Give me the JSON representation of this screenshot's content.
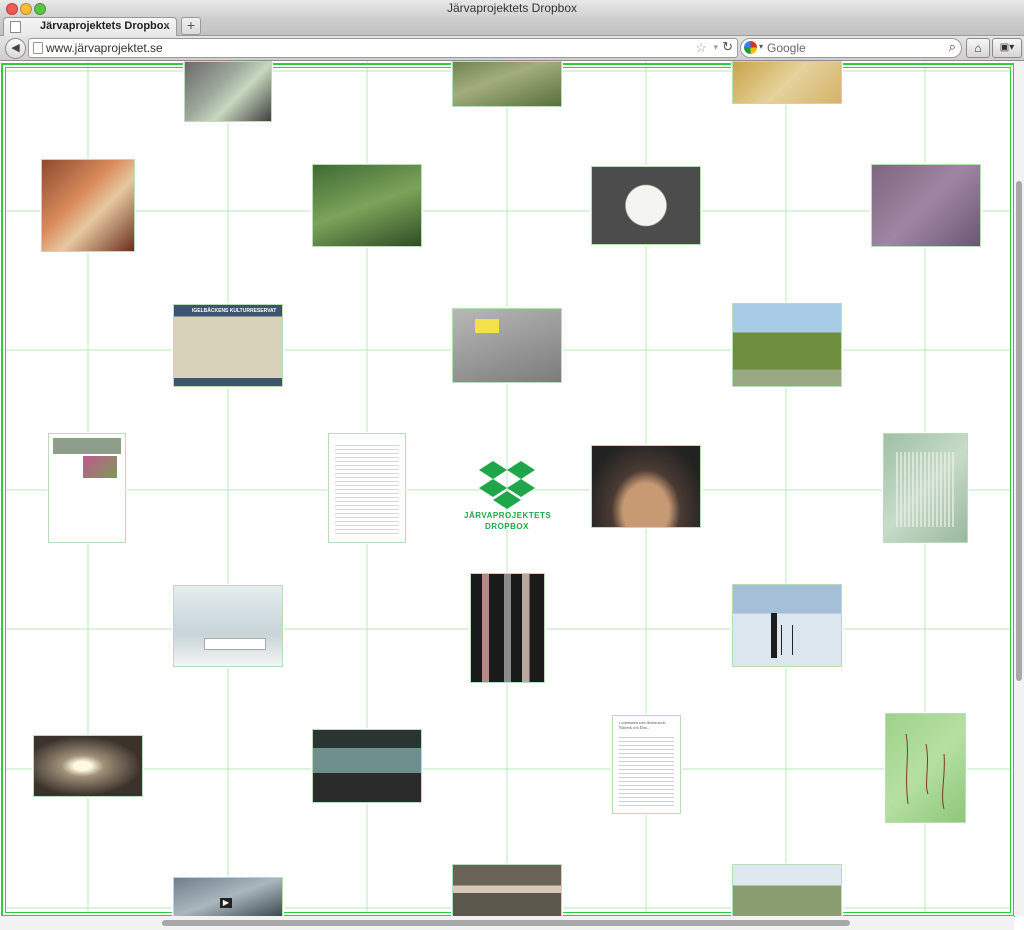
{
  "window": {
    "title": "Järvaprojektets Dropbox"
  },
  "tab": {
    "label": "Järvaprojektets Dropbox",
    "close": "×",
    "new_tab": "+"
  },
  "nav": {
    "back": "◀",
    "url": "www.järvaprojektet.se",
    "search_placeholder": "Google",
    "home": "⌂",
    "tools": "▣▾"
  },
  "logo": {
    "line1": "JÄRVAPROJEKTETS",
    "line2": "DROPBOX"
  },
  "sign": {
    "title": "IGELBÄCKENS KULTURRESERVAT"
  },
  "page_text": {
    "doc_snippet": "i sommaren som dessutom är Nätverk och Dim..."
  },
  "colors": {
    "accent": "#2ecc40",
    "grid": "#b9e8b9",
    "logo": "#1fa64a"
  },
  "thumbnails": [
    {
      "name": "thumb-wall-notes",
      "bg": "linear-gradient(135deg,#6a6a6a,#9da89b 40%,#c8d8c0 60%,#3e3e3e)"
    },
    {
      "name": "thumb-aerial-field",
      "bg": "linear-gradient(160deg,#6f8450,#a3ad7d 40%,#58703d)"
    },
    {
      "name": "thumb-scaffold",
      "bg": "linear-gradient(135deg,#c9a34a,#e6d29b 50%,#d4b36a)"
    },
    {
      "name": "thumb-jars",
      "bg": "linear-gradient(135deg,#8c4a2e,#d98a5a 40%,#e7c9a0 60%,#6b2d1d)"
    },
    {
      "name": "thumb-forest-video",
      "bg": "linear-gradient(160deg,#3f6b34,#7ca35a 50%,#2f4d25)"
    },
    {
      "name": "thumb-envelope",
      "bg": "radial-gradient(circle at 50% 50%,#f4f4f0 0 30%,#4c4c4c 32%)"
    },
    {
      "name": "thumb-pinboard",
      "bg": "linear-gradient(135deg,#7e6680,#9f87a3 50%,#6c5570)"
    },
    {
      "name": "thumb-reserve-sign",
      "bg": "linear-gradient(#3d5470 0 14%,#d9d2bb 14% 90%,#3d5470 90%)"
    },
    {
      "name": "thumb-3d-model",
      "bg": "linear-gradient(160deg,#b8b8b8,#9a9a9a 50%,#7c7c7c)"
    },
    {
      "name": "thumb-hill",
      "bg": "linear-gradient(#a9cce6 0 35%,#6e8e3d 35% 80%,#9aa884 80%)"
    },
    {
      "name": "thumb-webpage",
      "bg": "#ffffff"
    },
    {
      "name": "thumb-document",
      "bg": "#ffffff"
    },
    {
      "name": "thumb-lizard",
      "bg": "radial-gradient(ellipse at 50% 80%,#c79a74 0 30%,#4a3a33 45%,#222 80%)"
    },
    {
      "name": "thumb-green-print",
      "bg": "linear-gradient(135deg,#9fbfa6,#c7dcc9 50%,#9ab89f)"
    },
    {
      "name": "thumb-gallery-room",
      "bg": "linear-gradient(180deg,#e6ecef,#c8d4d8 60%,#f4f4f4)"
    },
    {
      "name": "thumb-tubes",
      "bg": "linear-gradient(90deg,#1a1a1a 0 15%,#b8878a 15% 25%,#1a1a1a 25% 45%,#8c8c8c 45% 55%,#1a1a1a 55% 70%,#b8a8a0 70% 80%,#1a1a1a 80%)"
    },
    {
      "name": "thumb-snow-camera",
      "bg": "linear-gradient(#a4bfd6 0 35%,#dbe6ee 35%)"
    },
    {
      "name": "thumb-tunnel",
      "bg": "radial-gradient(ellipse at 45% 50%,#fffbe2 0 10%,#a0907a 25%,#3a322b 70%)"
    },
    {
      "name": "thumb-projection",
      "bg": "linear-gradient(180deg,#2a3430 0 25%,#6f8f8c 25% 60%,#2b2b2b 60%)"
    },
    {
      "name": "thumb-text-page",
      "bg": "#ffffff"
    },
    {
      "name": "thumb-herbarium",
      "bg": "linear-gradient(135deg,#9fd18a,#b6e0a2 50%,#8ec779)"
    },
    {
      "name": "thumb-video-bottom",
      "bg": "linear-gradient(160deg,#6f7f8a,#aab7bf 50%,#3c4a52)"
    },
    {
      "name": "thumb-pigs",
      "bg": "linear-gradient(#6a6458 0 40%,#d9c8b8 40% 55%,#5c574d 55%)"
    },
    {
      "name": "thumb-street",
      "bg": "linear-gradient(#dfe8ee 0 40%,#8a9d70 40%)"
    }
  ]
}
